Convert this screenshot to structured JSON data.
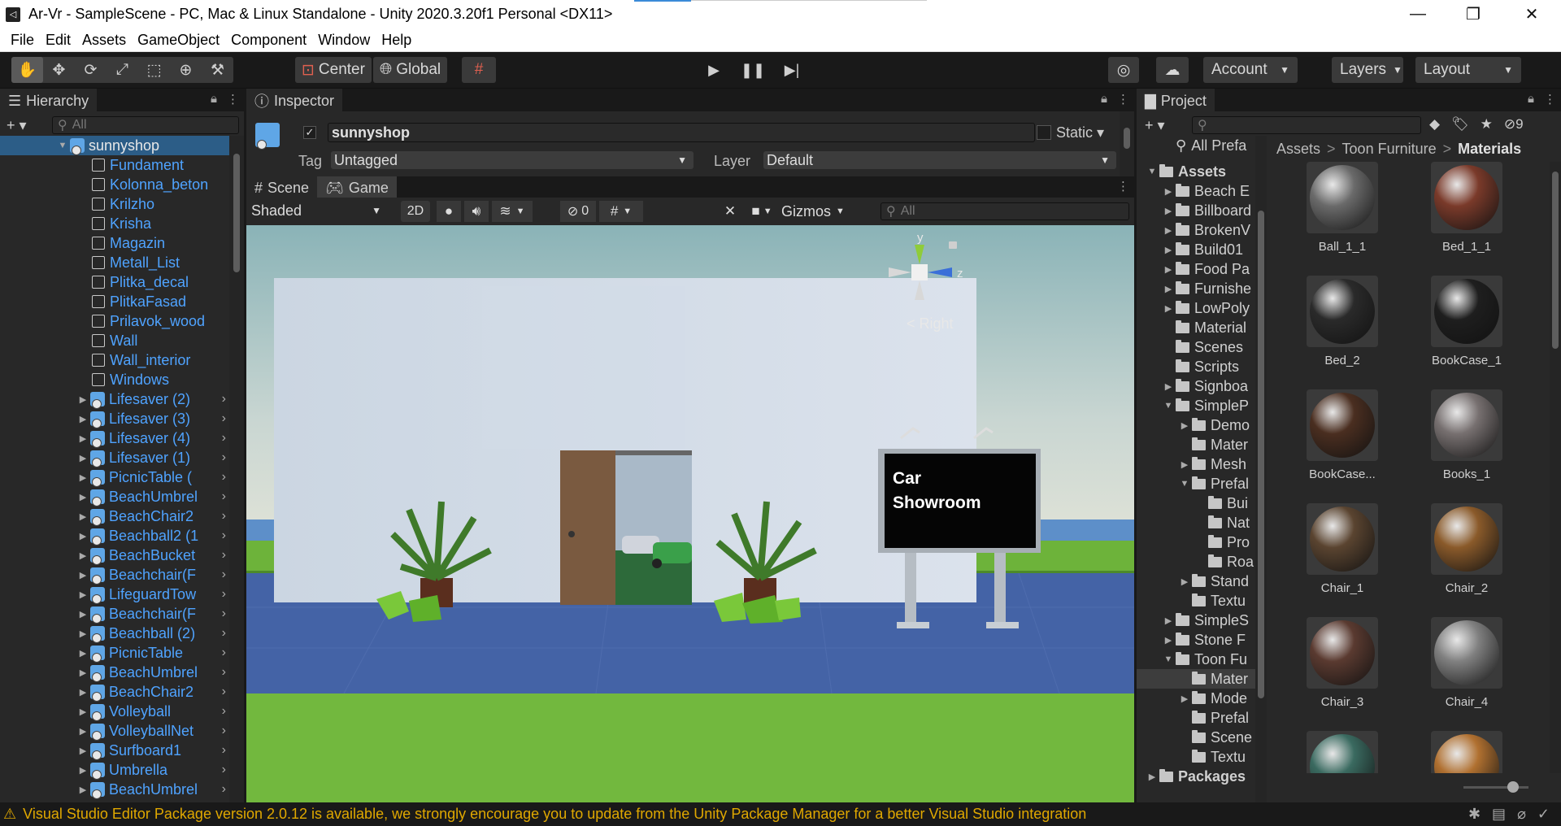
{
  "window": {
    "title": "Ar-Vr - SampleScene - PC, Mac & Linux Standalone - Unity 2020.3.20f1 Personal <DX11>"
  },
  "menu": [
    "File",
    "Edit",
    "Assets",
    "GameObject",
    "Component",
    "Window",
    "Help"
  ],
  "toolbar": {
    "pivot": "Center",
    "space": "Global",
    "account": "Account",
    "layers": "Layers",
    "layout": "Layout"
  },
  "hierarchy": {
    "tab": "Hierarchy",
    "search_placeholder": "All",
    "root": "sunnyshop",
    "items": [
      {
        "label": "Fundament",
        "type": "mesh"
      },
      {
        "label": "Kolonna_beton",
        "type": "mesh"
      },
      {
        "label": "Krilzho",
        "type": "mesh"
      },
      {
        "label": "Krisha",
        "type": "mesh"
      },
      {
        "label": "Magazin",
        "type": "mesh"
      },
      {
        "label": "Metall_List",
        "type": "mesh"
      },
      {
        "label": "Plitka_decal",
        "type": "mesh"
      },
      {
        "label": "PlitkaFasad",
        "type": "mesh"
      },
      {
        "label": "Prilavok_wood",
        "type": "mesh"
      },
      {
        "label": "Wall",
        "type": "mesh"
      },
      {
        "label": "Wall_interior",
        "type": "mesh"
      },
      {
        "label": "Windows",
        "type": "mesh"
      },
      {
        "label": "Lifesaver (2)",
        "type": "prefab"
      },
      {
        "label": "Lifesaver (3)",
        "type": "prefab"
      },
      {
        "label": "Lifesaver (4)",
        "type": "prefab"
      },
      {
        "label": "Lifesaver (1)",
        "type": "prefab"
      },
      {
        "label": "PicnicTable (",
        "type": "prefab"
      },
      {
        "label": "BeachUmbrel",
        "type": "prefab"
      },
      {
        "label": "BeachChair2",
        "type": "prefab"
      },
      {
        "label": "Beachball2 (1",
        "type": "prefab"
      },
      {
        "label": "BeachBucket",
        "type": "prefab"
      },
      {
        "label": "Beachchair(F",
        "type": "prefab"
      },
      {
        "label": "LifeguardTow",
        "type": "prefab"
      },
      {
        "label": "Beachchair(F",
        "type": "prefab"
      },
      {
        "label": "Beachball (2)",
        "type": "prefab"
      },
      {
        "label": "PicnicTable",
        "type": "prefab"
      },
      {
        "label": "BeachUmbrel",
        "type": "prefab"
      },
      {
        "label": "BeachChair2",
        "type": "prefab"
      },
      {
        "label": "Volleyball",
        "type": "prefab"
      },
      {
        "label": "VolleyballNet",
        "type": "prefab"
      },
      {
        "label": "Surfboard1",
        "type": "prefab"
      },
      {
        "label": "Umbrella",
        "type": "prefab"
      },
      {
        "label": "BeachUmbrel",
        "type": "prefab"
      }
    ]
  },
  "inspector": {
    "tab": "Inspector",
    "object_name": "sunnyshop",
    "static_label": "Static",
    "tag_label": "Tag",
    "tag_value": "Untagged",
    "layer_label": "Layer",
    "layer_value": "Default"
  },
  "scene": {
    "tabs": [
      "Scene",
      "Game"
    ],
    "shading": "Shaded",
    "mode_2d": "2D",
    "hidden_count": "0",
    "gizmos": "Gizmos",
    "search_placeholder": "All",
    "gizmo_view": "Right",
    "axis_y": "y",
    "axis_z": "z",
    "sign_text": [
      "Car",
      "Showroom"
    ]
  },
  "project": {
    "tab": "Project",
    "hidden_count": "9",
    "favorites_item": "All Prefa",
    "breadcrumb": [
      "Assets",
      "Toon Furniture",
      "Materials"
    ],
    "tree": [
      {
        "label": "Assets",
        "depth": 0,
        "expand": "open",
        "bold": true
      },
      {
        "label": "Beach E",
        "depth": 1,
        "expand": "closed"
      },
      {
        "label": "Billboard",
        "depth": 1,
        "expand": "closed"
      },
      {
        "label": "BrokenV",
        "depth": 1,
        "expand": "closed"
      },
      {
        "label": "Build01",
        "depth": 1,
        "expand": "closed"
      },
      {
        "label": "Food Pa",
        "depth": 1,
        "expand": "closed"
      },
      {
        "label": "Furnishe",
        "depth": 1,
        "expand": "closed"
      },
      {
        "label": "LowPoly",
        "depth": 1,
        "expand": "closed"
      },
      {
        "label": "Material",
        "depth": 1,
        "expand": "none"
      },
      {
        "label": "Scenes",
        "depth": 1,
        "expand": "none"
      },
      {
        "label": "Scripts",
        "depth": 1,
        "expand": "none"
      },
      {
        "label": "Signboa",
        "depth": 1,
        "expand": "closed"
      },
      {
        "label": "SimpleP",
        "depth": 1,
        "expand": "open"
      },
      {
        "label": "Demo",
        "depth": 2,
        "expand": "closed"
      },
      {
        "label": "Mater",
        "depth": 2,
        "expand": "none"
      },
      {
        "label": "Mesh",
        "depth": 2,
        "expand": "closed"
      },
      {
        "label": "Prefal",
        "depth": 2,
        "expand": "open"
      },
      {
        "label": "Bui",
        "depth": 3,
        "expand": "none"
      },
      {
        "label": "Nat",
        "depth": 3,
        "expand": "none"
      },
      {
        "label": "Pro",
        "depth": 3,
        "expand": "none"
      },
      {
        "label": "Roa",
        "depth": 3,
        "expand": "none"
      },
      {
        "label": "Stand",
        "depth": 2,
        "expand": "closed"
      },
      {
        "label": "Textu",
        "depth": 2,
        "expand": "none"
      },
      {
        "label": "SimpleS",
        "depth": 1,
        "expand": "closed"
      },
      {
        "label": "Stone F",
        "depth": 1,
        "expand": "closed"
      },
      {
        "label": "Toon Fu",
        "depth": 1,
        "expand": "open"
      },
      {
        "label": "Mater",
        "depth": 2,
        "expand": "none",
        "selected": true
      },
      {
        "label": "Mode",
        "depth": 2,
        "expand": "closed"
      },
      {
        "label": "Prefal",
        "depth": 2,
        "expand": "none"
      },
      {
        "label": "Scene",
        "depth": 2,
        "expand": "none"
      },
      {
        "label": "Textu",
        "depth": 2,
        "expand": "none"
      },
      {
        "label": "Packages",
        "depth": 0,
        "expand": "closed",
        "bold": true
      }
    ],
    "assets": [
      {
        "label": "Ball_1_1",
        "color": "#6a6a6a"
      },
      {
        "label": "Bed_1_1",
        "color": "#7a3a2a"
      },
      {
        "label": "Bed_2",
        "color": "#2a2a2a"
      },
      {
        "label": "BookCase_1",
        "color": "#1e1e1e"
      },
      {
        "label": "BookCase...",
        "color": "#4a2e20"
      },
      {
        "label": "Books_1",
        "color": "#777070"
      },
      {
        "label": "Chair_1",
        "color": "#5a4430"
      },
      {
        "label": "Chair_2",
        "color": "#8a5a2a"
      },
      {
        "label": "Chair_3",
        "color": "#5a3a30"
      },
      {
        "label": "Chair_4",
        "color": "#808080"
      },
      {
        "label": "",
        "color": "#3a6a60"
      },
      {
        "label": "",
        "color": "#b07030"
      }
    ]
  },
  "status_bar": {
    "message": "Visual Studio Editor Package version 2.0.12 is available, we strongly encourage you to update from the Unity Package Manager for a better Visual Studio integration"
  }
}
